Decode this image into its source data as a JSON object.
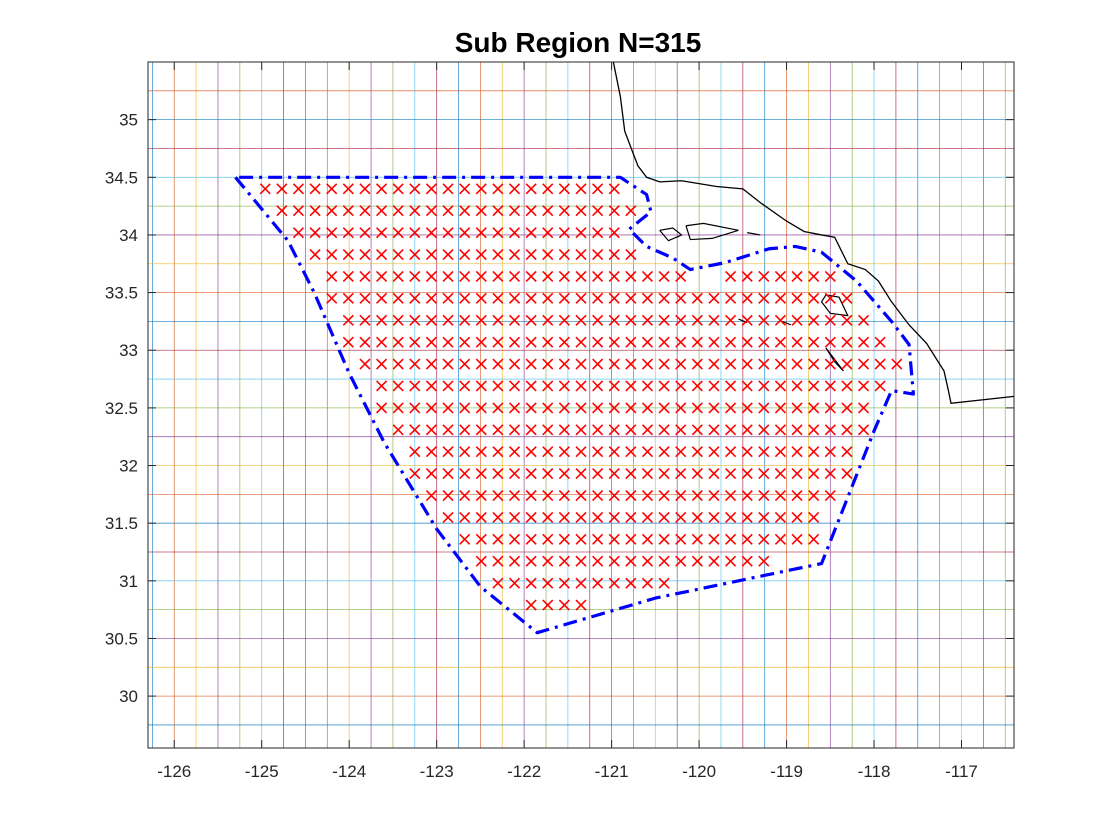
{
  "chart_data": {
    "type": "scatter",
    "title": "Sub Region N=315",
    "xlabel": "",
    "ylabel": "",
    "xlim": [
      -126.3,
      -116.4
    ],
    "ylim": [
      29.55,
      35.5
    ],
    "xticks": [
      -126,
      -125,
      -124,
      -123,
      -122,
      -121,
      -120,
      -119,
      -118,
      -117
    ],
    "yticks": [
      30,
      30.5,
      31,
      31.5,
      32,
      32.5,
      33,
      33.5,
      34,
      34.5,
      35
    ],
    "x_tick_labels": [
      "-126",
      "-125",
      "-124",
      "-123",
      "-122",
      "-121",
      "-120",
      "-119",
      "-118",
      "-117"
    ],
    "y_tick_labels": [
      "30",
      "30.5",
      "31",
      "31.5",
      "32",
      "32.5",
      "33",
      "33.5",
      "34",
      "34.5",
      "35"
    ],
    "grid": true,
    "grid_step": {
      "x": 0.25,
      "y": 0.25
    },
    "colors": {
      "points": "#ff0000",
      "boundary": "#0000ff",
      "coastline": "#000000",
      "grid_palette": [
        "#0072bd",
        "#d95319",
        "#edb120",
        "#7e2f8e",
        "#77ac30",
        "#4dbeee",
        "#a2142f"
      ]
    },
    "boundary": {
      "style": "dash-dot",
      "lon": [
        -125.3,
        -124.7,
        -124.4,
        -124.0,
        -123.6,
        -123.0,
        -122.5,
        -121.85,
        -120.5,
        -118.6,
        -118.0,
        -117.8,
        -117.55,
        -117.6,
        -117.8,
        -118.2,
        -118.6,
        -118.9,
        -119.2,
        -119.7,
        -120.1,
        -120.3,
        -120.6,
        -120.8,
        -120.55,
        -120.6,
        -120.9,
        -125.3
      ],
      "lat": [
        34.5,
        33.95,
        33.5,
        32.8,
        32.2,
        31.45,
        30.95,
        30.55,
        30.85,
        31.15,
        32.3,
        32.65,
        32.62,
        33.05,
        33.25,
        33.6,
        33.85,
        33.9,
        33.88,
        33.76,
        33.7,
        33.8,
        33.9,
        34.05,
        34.2,
        34.35,
        34.5,
        34.5
      ],
      "inset": 0.1,
      "spacing": 0.19
    },
    "coastline": {
      "lon": [
        -120.98,
        -120.9,
        -120.85,
        -120.7,
        -120.6,
        -120.45,
        -120.2,
        -119.8,
        -119.5,
        -119.3,
        -119.0,
        -118.8,
        -118.6,
        -118.45,
        -118.3,
        -118.1,
        -117.95,
        -117.8,
        -117.6,
        -117.4,
        -117.2,
        -117.15,
        -117.12,
        -116.4
      ],
      "lat": [
        35.5,
        35.2,
        34.9,
        34.6,
        34.5,
        34.46,
        34.47,
        34.42,
        34.4,
        34.28,
        34.12,
        34.03,
        34.0,
        33.98,
        33.75,
        33.7,
        33.6,
        33.42,
        33.22,
        33.06,
        32.82,
        32.65,
        32.54,
        32.6
      ],
      "islands": [
        {
          "lon": [
            -120.45,
            -120.3,
            -120.2,
            -120.35,
            -120.45
          ],
          "lat": [
            34.04,
            34.06,
            34.0,
            33.95,
            34.04
          ]
        },
        {
          "lon": [
            -120.15,
            -119.95,
            -119.55,
            -119.85,
            -120.1,
            -120.15
          ],
          "lat": [
            34.08,
            34.1,
            34.04,
            33.97,
            33.96,
            34.08
          ]
        },
        {
          "lon": [
            -119.45,
            -119.3,
            -119.45
          ],
          "lat": [
            34.02,
            34.0,
            34.02
          ]
        },
        {
          "lon": [
            -118.55,
            -118.4,
            -118.3,
            -118.5,
            -118.6,
            -118.55
          ],
          "lat": [
            33.48,
            33.46,
            33.3,
            33.32,
            33.42,
            33.48
          ]
        },
        {
          "lon": [
            -118.55,
            -118.45,
            -118.35,
            -118.55
          ],
          "lat": [
            33.02,
            32.9,
            32.82,
            33.02
          ]
        },
        {
          "lon": [
            -119.05,
            -118.95,
            -119.05
          ],
          "lat": [
            33.25,
            33.22,
            33.25
          ]
        },
        {
          "lon": [
            -119.55,
            -119.45,
            -119.55
          ],
          "lat": [
            33.27,
            33.24,
            33.27
          ]
        }
      ]
    }
  }
}
